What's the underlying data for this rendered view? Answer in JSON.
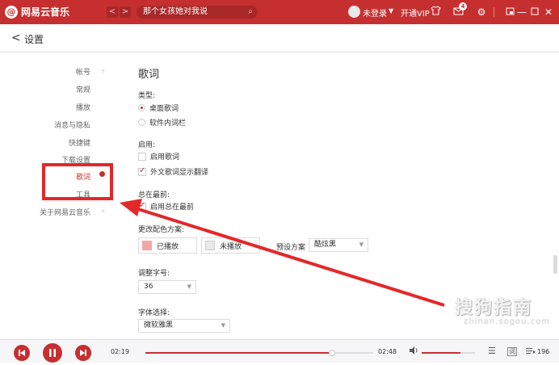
{
  "app": {
    "title": "网易云音乐",
    "logo_letter": "@"
  },
  "titlebar": {
    "back_arrow": "<",
    "forward_arrow": ">",
    "search_text": "那个女孩她对我说",
    "login_text": "未登录",
    "vip_text": "开通VIP",
    "mail_badge": "4",
    "icons": [
      "skin-icon",
      "mail-icon",
      "settings-icon",
      "mini-mode-icon",
      "minimize-icon",
      "maximize-icon",
      "close-icon"
    ]
  },
  "page": {
    "back_arrow": "<",
    "title": "设置"
  },
  "sidebar": {
    "items": [
      {
        "label": "帐号"
      },
      {
        "label": "常规"
      },
      {
        "label": "播放"
      },
      {
        "label": "消息与隐私"
      },
      {
        "label": "快捷键"
      },
      {
        "label": "下载设置"
      },
      {
        "label": "歌词",
        "active": true
      },
      {
        "label": "工具"
      },
      {
        "label": "关于网易云音乐"
      }
    ]
  },
  "lyrics": {
    "section_title": "歌词",
    "type_label": "类型:",
    "type_options": [
      {
        "label": "桌面歌词",
        "selected": true
      },
      {
        "label": "软件内词栏",
        "selected": false
      }
    ],
    "enable_label": "启用:",
    "enable_options": [
      {
        "label": "启用歌词",
        "checked": false
      },
      {
        "label": "外文歌词显示翻译",
        "checked": true
      }
    ],
    "ontop_label": "总在最前:",
    "ontop_options": [
      {
        "label": "启用总在最前",
        "checked": true
      }
    ],
    "color_label": "更改配色方案:",
    "played_label": "已播放",
    "unplayed_label": "未播放",
    "preset_label": "预设方案",
    "preset_value": "酷炫黑",
    "fontsize_label": "调整字号:",
    "fontsize_value": "36",
    "font_label": "字体选择:",
    "font_value": "微软雅黑"
  },
  "player": {
    "current_time": "02:19",
    "total_time": "02:48",
    "progress": 0.82,
    "volume": 0.72,
    "lyric_button": "词",
    "playlist_count": "196"
  },
  "colors": {
    "brand_red": "#c62f2f",
    "played_swatch": "#f2a6a6",
    "unplayed_swatch": "#eaeaea",
    "annotation_red": "#e3282a"
  },
  "watermark": {
    "text": "搜狗指南",
    "sub": "zhinan.sogou.com"
  }
}
